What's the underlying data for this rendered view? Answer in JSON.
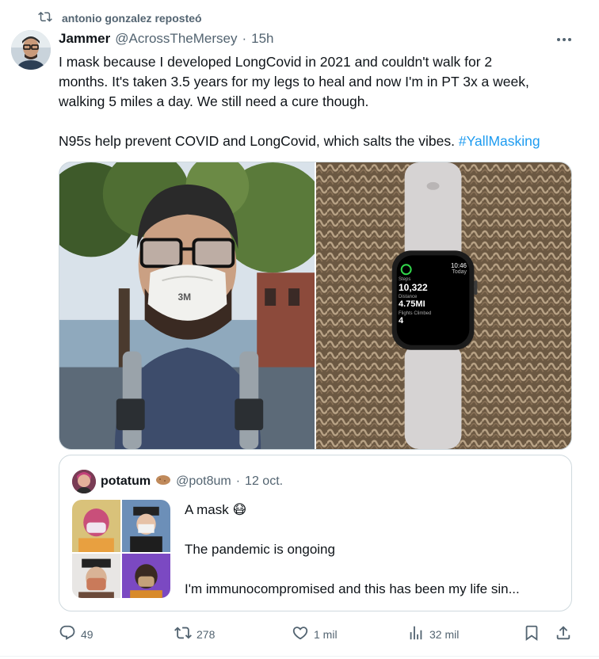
{
  "repost": {
    "label": "antonio gonzalez reposteó",
    "icon": "repost-icon"
  },
  "tweet": {
    "author_name": "Jammer",
    "author_handle": "@AcrossTheMersey",
    "separator": "·",
    "time": "15h",
    "more_icon": "more-icon",
    "text_line1": "I mask because I developed LongCovid in 2021 and couldn't walk for 2",
    "text_line2": "months.  It's taken 3.5 years for my legs to heal and now I'm in PT 3x a week,",
    "text_line3": "walking 5 miles a day.  We still need a cure though.",
    "text_line4": "N95s help prevent COVID and LongCovid, which salts the vibes. ",
    "hashtag": "#YallMasking",
    "watch": {
      "time": "10:46",
      "period": "Today",
      "steps_label": "Steps",
      "steps": "10,322",
      "distance_label": "Distance",
      "distance": "4.75MI",
      "flights_label": "Flights Climbed",
      "flights": "4"
    }
  },
  "quote": {
    "name": "potatum",
    "handle": "@pot8um",
    "separator": "·",
    "date": "12 oct.",
    "line1": "A mask 😷",
    "line2": "The pandemic is ongoing",
    "line3": "I'm immunocompromised and this has been my life sin..."
  },
  "actions": {
    "replies": "49",
    "reposts": "278",
    "likes": "1 mil",
    "views": "32 mil"
  },
  "colors": {
    "accent": "#1d9bf0",
    "muted": "#536471",
    "text": "#0f1419",
    "border": "#cfd9de"
  }
}
